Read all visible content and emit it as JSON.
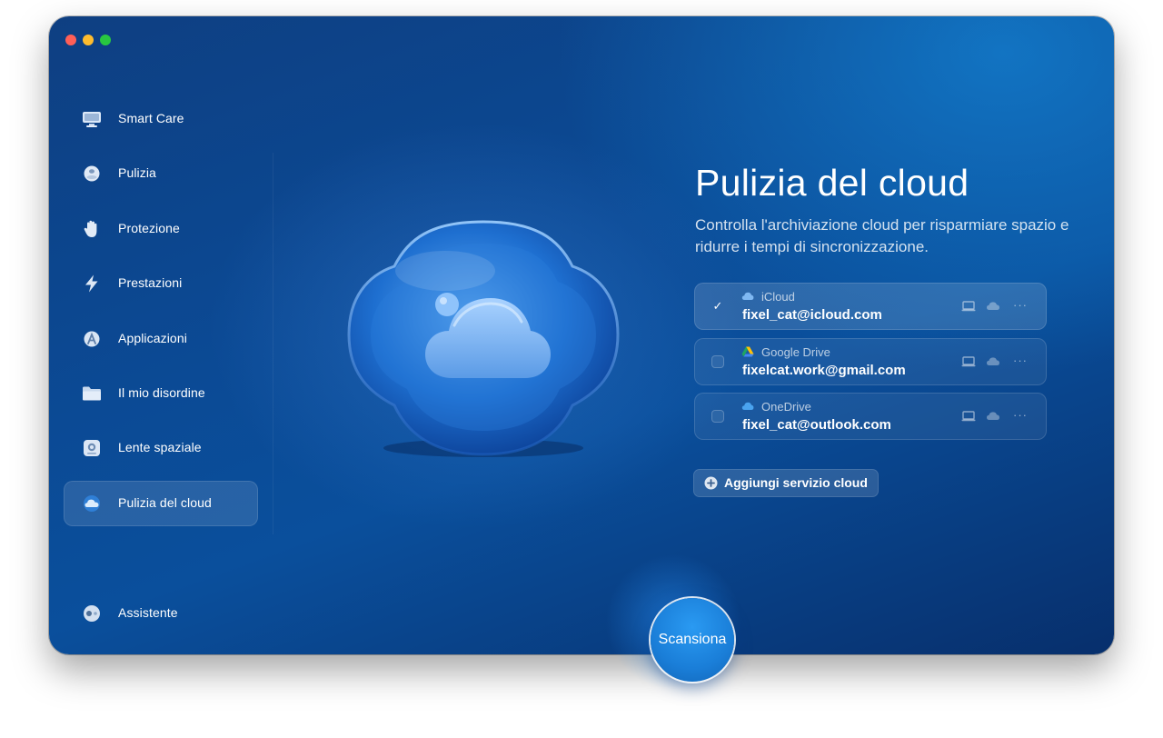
{
  "sidebar": {
    "items": [
      {
        "label": "Smart Care",
        "icon": "monitor-icon"
      },
      {
        "label": "Pulizia",
        "icon": "cleanup-sphere-icon"
      },
      {
        "label": "Protezione",
        "icon": "hand-icon"
      },
      {
        "label": "Prestazioni",
        "icon": "lightning-icon"
      },
      {
        "label": "Applicazioni",
        "icon": "applications-icon"
      },
      {
        "label": "Il mio disordine",
        "icon": "folder-icon"
      },
      {
        "label": "Lente spaziale",
        "icon": "space-lens-icon"
      },
      {
        "label": "Pulizia del cloud",
        "icon": "cloud-icon",
        "active": true
      }
    ],
    "assistant": {
      "label": "Assistente",
      "icon": "assistant-icon"
    }
  },
  "main": {
    "title": "Pulizia del cloud",
    "subtitle": "Controlla l'archiviazione cloud per risparmiare spazio e ridurre i tempi di sincronizzazione.",
    "accounts": [
      {
        "service": "iCloud",
        "email": "fixel_cat@icloud.com",
        "checked": true,
        "icon": "icloud-icon"
      },
      {
        "service": "Google Drive",
        "email": "fixelcat.work@gmail.com",
        "checked": false,
        "icon": "google-drive-icon"
      },
      {
        "service": "OneDrive",
        "email": "fixel_cat@outlook.com",
        "checked": false,
        "icon": "onedrive-icon"
      }
    ],
    "checkmark": "✓",
    "more_label": "···",
    "add_service_label": "Aggiungi servizio cloud",
    "scan_label": "Scansiona"
  },
  "colors": {
    "background_top": "#0e3f82",
    "background_bottom": "#072f6c",
    "scan_button": "#1a7ed8",
    "traffic_red": "#ff5f57",
    "traffic_yellow": "#febc2e",
    "traffic_green": "#28c840"
  }
}
